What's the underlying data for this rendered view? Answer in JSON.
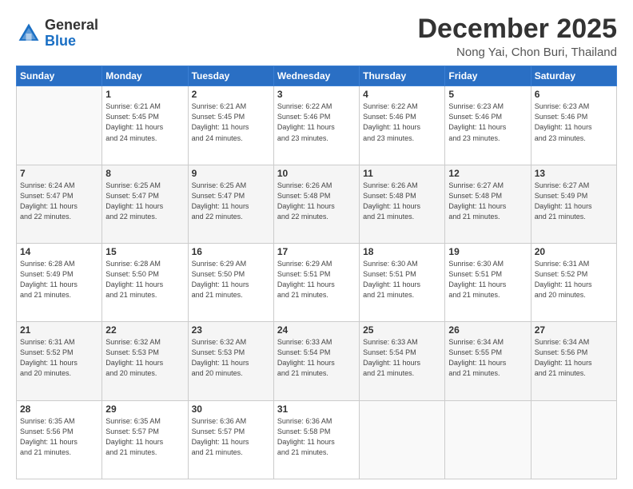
{
  "logo": {
    "general": "General",
    "blue": "Blue"
  },
  "header": {
    "month": "December 2025",
    "location": "Nong Yai, Chon Buri, Thailand"
  },
  "days_of_week": [
    "Sunday",
    "Monday",
    "Tuesday",
    "Wednesday",
    "Thursday",
    "Friday",
    "Saturday"
  ],
  "weeks": [
    [
      {
        "day": "",
        "info": ""
      },
      {
        "day": "1",
        "info": "Sunrise: 6:21 AM\nSunset: 5:45 PM\nDaylight: 11 hours\nand 24 minutes."
      },
      {
        "day": "2",
        "info": "Sunrise: 6:21 AM\nSunset: 5:45 PM\nDaylight: 11 hours\nand 24 minutes."
      },
      {
        "day": "3",
        "info": "Sunrise: 6:22 AM\nSunset: 5:46 PM\nDaylight: 11 hours\nand 23 minutes."
      },
      {
        "day": "4",
        "info": "Sunrise: 6:22 AM\nSunset: 5:46 PM\nDaylight: 11 hours\nand 23 minutes."
      },
      {
        "day": "5",
        "info": "Sunrise: 6:23 AM\nSunset: 5:46 PM\nDaylight: 11 hours\nand 23 minutes."
      },
      {
        "day": "6",
        "info": "Sunrise: 6:23 AM\nSunset: 5:46 PM\nDaylight: 11 hours\nand 23 minutes."
      }
    ],
    [
      {
        "day": "7",
        "info": "Sunrise: 6:24 AM\nSunset: 5:47 PM\nDaylight: 11 hours\nand 22 minutes."
      },
      {
        "day": "8",
        "info": "Sunrise: 6:25 AM\nSunset: 5:47 PM\nDaylight: 11 hours\nand 22 minutes."
      },
      {
        "day": "9",
        "info": "Sunrise: 6:25 AM\nSunset: 5:47 PM\nDaylight: 11 hours\nand 22 minutes."
      },
      {
        "day": "10",
        "info": "Sunrise: 6:26 AM\nSunset: 5:48 PM\nDaylight: 11 hours\nand 22 minutes."
      },
      {
        "day": "11",
        "info": "Sunrise: 6:26 AM\nSunset: 5:48 PM\nDaylight: 11 hours\nand 21 minutes."
      },
      {
        "day": "12",
        "info": "Sunrise: 6:27 AM\nSunset: 5:48 PM\nDaylight: 11 hours\nand 21 minutes."
      },
      {
        "day": "13",
        "info": "Sunrise: 6:27 AM\nSunset: 5:49 PM\nDaylight: 11 hours\nand 21 minutes."
      }
    ],
    [
      {
        "day": "14",
        "info": "Sunrise: 6:28 AM\nSunset: 5:49 PM\nDaylight: 11 hours\nand 21 minutes."
      },
      {
        "day": "15",
        "info": "Sunrise: 6:28 AM\nSunset: 5:50 PM\nDaylight: 11 hours\nand 21 minutes."
      },
      {
        "day": "16",
        "info": "Sunrise: 6:29 AM\nSunset: 5:50 PM\nDaylight: 11 hours\nand 21 minutes."
      },
      {
        "day": "17",
        "info": "Sunrise: 6:29 AM\nSunset: 5:51 PM\nDaylight: 11 hours\nand 21 minutes."
      },
      {
        "day": "18",
        "info": "Sunrise: 6:30 AM\nSunset: 5:51 PM\nDaylight: 11 hours\nand 21 minutes."
      },
      {
        "day": "19",
        "info": "Sunrise: 6:30 AM\nSunset: 5:51 PM\nDaylight: 11 hours\nand 21 minutes."
      },
      {
        "day": "20",
        "info": "Sunrise: 6:31 AM\nSunset: 5:52 PM\nDaylight: 11 hours\nand 20 minutes."
      }
    ],
    [
      {
        "day": "21",
        "info": "Sunrise: 6:31 AM\nSunset: 5:52 PM\nDaylight: 11 hours\nand 20 minutes."
      },
      {
        "day": "22",
        "info": "Sunrise: 6:32 AM\nSunset: 5:53 PM\nDaylight: 11 hours\nand 20 minutes."
      },
      {
        "day": "23",
        "info": "Sunrise: 6:32 AM\nSunset: 5:53 PM\nDaylight: 11 hours\nand 20 minutes."
      },
      {
        "day": "24",
        "info": "Sunrise: 6:33 AM\nSunset: 5:54 PM\nDaylight: 11 hours\nand 21 minutes."
      },
      {
        "day": "25",
        "info": "Sunrise: 6:33 AM\nSunset: 5:54 PM\nDaylight: 11 hours\nand 21 minutes."
      },
      {
        "day": "26",
        "info": "Sunrise: 6:34 AM\nSunset: 5:55 PM\nDaylight: 11 hours\nand 21 minutes."
      },
      {
        "day": "27",
        "info": "Sunrise: 6:34 AM\nSunset: 5:56 PM\nDaylight: 11 hours\nand 21 minutes."
      }
    ],
    [
      {
        "day": "28",
        "info": "Sunrise: 6:35 AM\nSunset: 5:56 PM\nDaylight: 11 hours\nand 21 minutes."
      },
      {
        "day": "29",
        "info": "Sunrise: 6:35 AM\nSunset: 5:57 PM\nDaylight: 11 hours\nand 21 minutes."
      },
      {
        "day": "30",
        "info": "Sunrise: 6:36 AM\nSunset: 5:57 PM\nDaylight: 11 hours\nand 21 minutes."
      },
      {
        "day": "31",
        "info": "Sunrise: 6:36 AM\nSunset: 5:58 PM\nDaylight: 11 hours\nand 21 minutes."
      },
      {
        "day": "",
        "info": ""
      },
      {
        "day": "",
        "info": ""
      },
      {
        "day": "",
        "info": ""
      }
    ]
  ]
}
